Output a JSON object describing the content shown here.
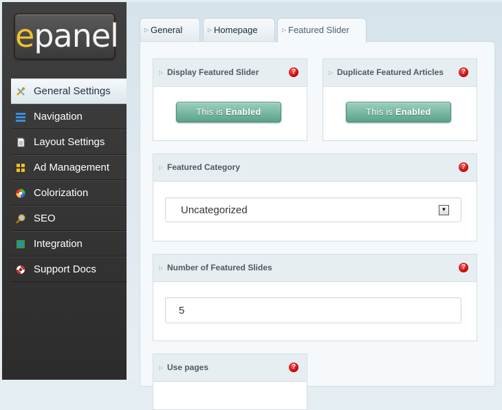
{
  "logo": {
    "first_letter": "e",
    "rest": "panel"
  },
  "sidebar": {
    "items": [
      {
        "label": "General Settings",
        "icon": "tools-icon",
        "active": true
      },
      {
        "label": "Navigation",
        "icon": "navigation-icon"
      },
      {
        "label": "Layout Settings",
        "icon": "document-icon"
      },
      {
        "label": "Ad Management",
        "icon": "grid-icon"
      },
      {
        "label": "Colorization",
        "icon": "color-wheel-icon"
      },
      {
        "label": "SEO",
        "icon": "magnifier-icon"
      },
      {
        "label": "Integration",
        "icon": "puzzle-icon"
      },
      {
        "label": "Support Docs",
        "icon": "lifebuoy-icon"
      }
    ]
  },
  "tabs": [
    {
      "label": "General"
    },
    {
      "label": "Homepage"
    },
    {
      "label": "Featured Slider",
      "active": true
    }
  ],
  "boxes": {
    "display_slider": {
      "title": "Display Featured Slider",
      "button_prefix": "This is ",
      "button_state": "Enabled"
    },
    "duplicate": {
      "title": "Duplicate Featured Articles",
      "button_prefix": "This is ",
      "button_state": "Enabled"
    },
    "category": {
      "title": "Featured Category",
      "value": "Uncategorized"
    },
    "num_slides": {
      "title": "Number of Featured Slides",
      "value": "5"
    },
    "use_pages": {
      "title": "Use pages"
    }
  },
  "help_symbol": "?",
  "colors": {
    "sidebar_bg": "#383838",
    "toggle_green": "#6fb39d",
    "help_red": "#cc0000",
    "logo_accent": "#f2c12e"
  }
}
